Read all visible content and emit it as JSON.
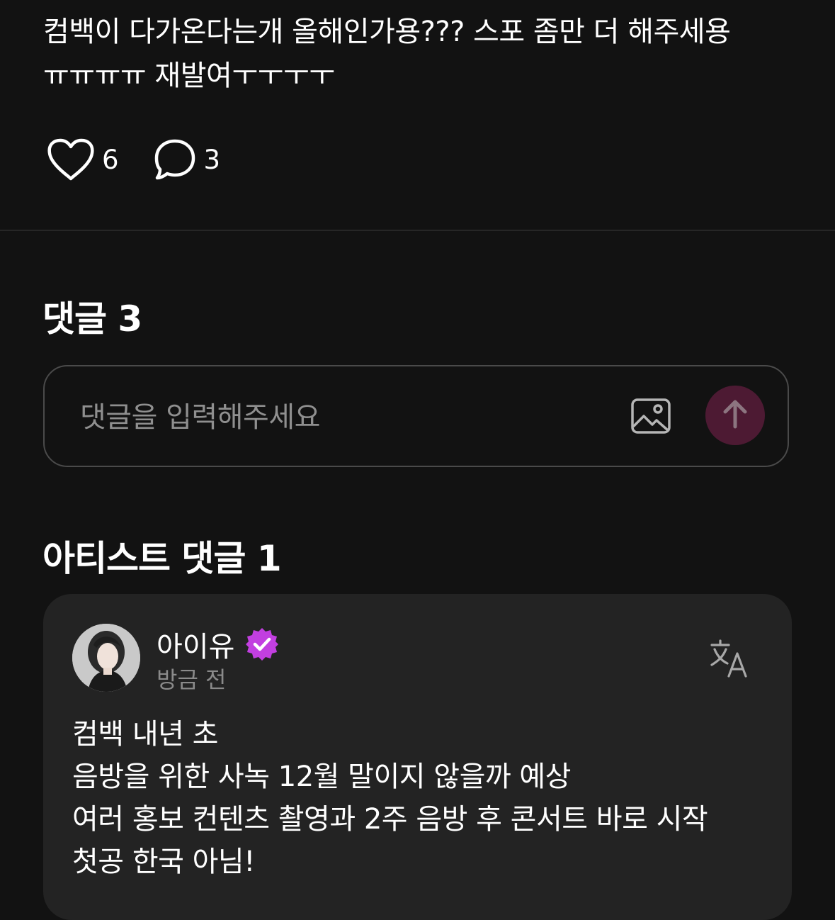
{
  "post": {
    "lines": [
      "컴백이 다가온다는개 올해인가용??? 스포 좀만 더 해주세용",
      "ㅠㅠㅠㅠ 재발여ㅜㅜㅜㅜ"
    ],
    "like_count": "6",
    "comment_count": "3"
  },
  "comments": {
    "title": "댓글 3",
    "input_placeholder": "댓글을 입력해주세요"
  },
  "artist_comments": {
    "title": "아티스트 댓글 1",
    "items": [
      {
        "author": "아이유",
        "time": "방금 전",
        "lines": [
          "컴백 내년 초",
          "음방을 위한 사녹 12월 말이지 않을까 예상",
          "여러 홍보 컨텐츠 촬영과 2주 음방 후 콘서트 바로 시작",
          "첫공 한국 아님!"
        ]
      }
    ]
  },
  "icons": {
    "like": "heart-outline-icon",
    "comment": "speech-bubble-icon",
    "image": "image-icon",
    "send": "arrow-up-icon",
    "verified": "verified-badge-icon",
    "translate": "translate-icon"
  },
  "colors": {
    "background": "#121212",
    "card": "#232323",
    "send_button": "#4d1a33",
    "verified": "#c23fe0"
  }
}
